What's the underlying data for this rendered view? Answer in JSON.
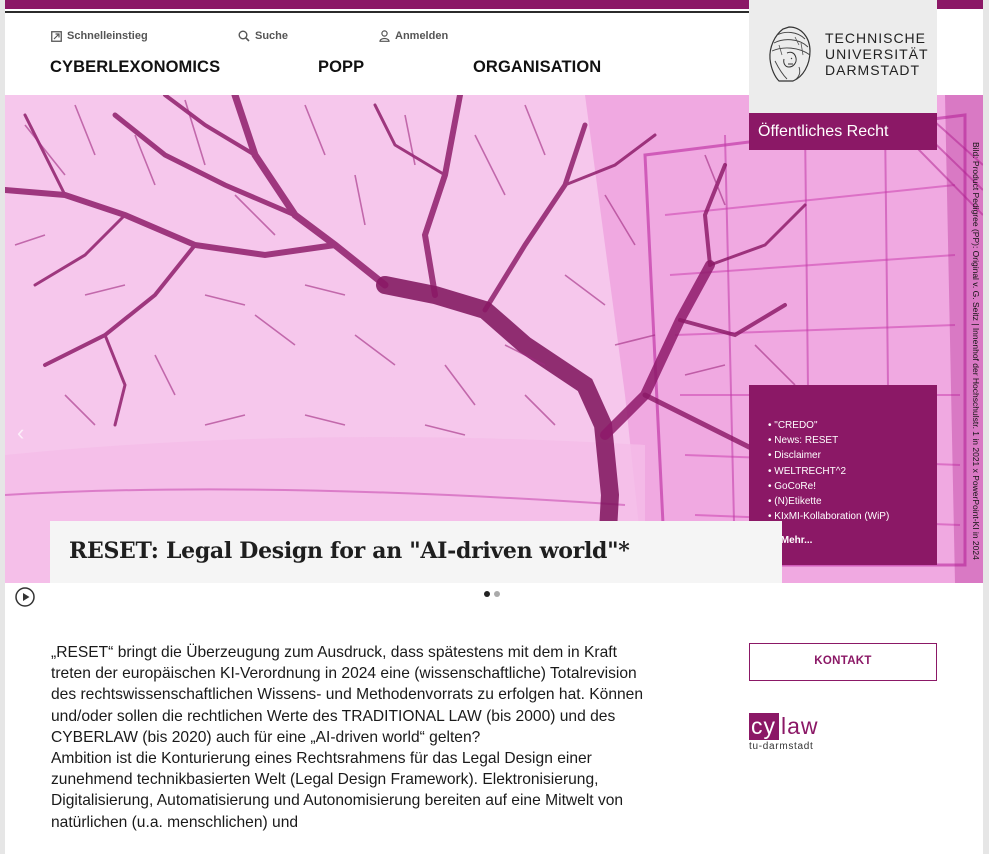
{
  "colors": {
    "brand": "#8b1866",
    "hero_tint": "#f6c8ec"
  },
  "quicknav": [
    {
      "label": "Schnelleinstieg",
      "icon": "box-arrow-icon"
    },
    {
      "label": "Suche",
      "icon": "search-icon"
    },
    {
      "label": "Anmelden",
      "icon": "user-icon"
    }
  ],
  "mainnav": [
    "CYBERLEXONOMICS",
    "POPP",
    "ORGANISATION"
  ],
  "logo": {
    "line1": "TECHNISCHE",
    "line2": "UNIVERSITÄT",
    "line3": "DARMSTADT"
  },
  "department": "Öffentliches Recht",
  "hero": {
    "title": "RESET: Legal Design for an \"AI-driven world\"*",
    "caption": "Bild: Product Pedigree (PP): Original v. G. Seitz | Innenhof der Hochschulstr. 1 in 2021 x PowerPoint-KI in 2024",
    "slides": 2,
    "active_slide": 1
  },
  "quicklinks": {
    "items": [
      "\"CREDO\"",
      "News: RESET",
      "Disclaimer",
      "WELTRECHT^2",
      "GoCoRe!",
      "(N)Etikette",
      "KIxMI-Kollaboration (WiP)"
    ],
    "more_label": "Mehr..."
  },
  "body": {
    "paragraph1": "„RESET“ bringt die Überzeugung zum Ausdruck, dass spätestens mit dem in Kraft treten der europäischen KI-Verordnung in 2024 eine (wissenschaftliche) Totalrevision des rechtswissenschaftlichen Wissens- und Methodenvorrats zu erfolgen hat. Können und/oder sollen die rechtlichen Werte des TRADITIONAL LAW (bis 2000) und des CYBERLAW (bis 2020) auch für eine „AI-driven world“ gelten?",
    "paragraph2": "Ambition ist die Konturierung eines Rechtsrahmens für das Legal Design einer zunehmend technikbasierten Welt (Legal Design Framework). Elektronisierung, Digitalisierung, Automatisierung und Autonomisierung bereiten auf eine Mitwelt von natürlichen (u.a. menschlichen) und"
  },
  "sidebar": {
    "contact_label": "KONTAKT",
    "cylaw": {
      "cy": "cy",
      "law": "law",
      "sub": "tu-darmstadt"
    }
  }
}
